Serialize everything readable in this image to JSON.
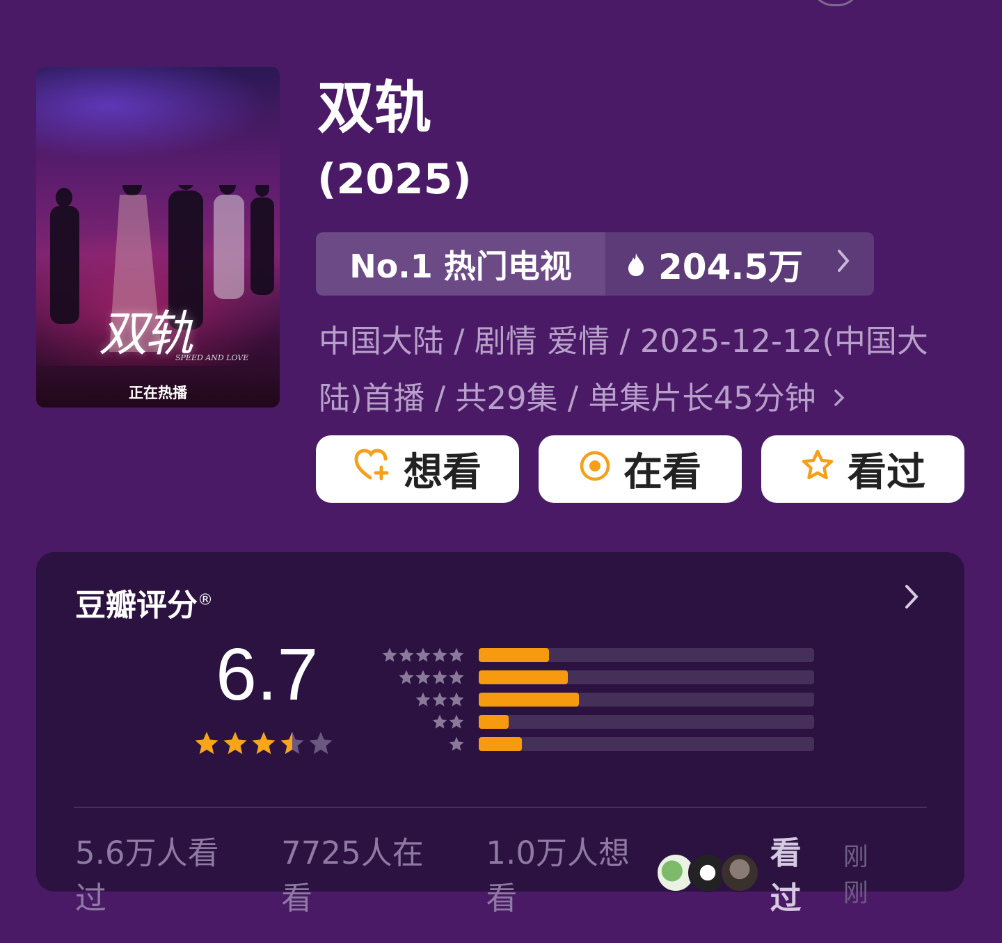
{
  "poster": {
    "art_title": "双轨",
    "art_subtitle": "SPEED AND LOVE",
    "tag": "正在热播"
  },
  "show": {
    "title": "双轨",
    "year": "(2025)"
  },
  "rank": {
    "label": "No.1 热门电视",
    "heat": "204.5万",
    "icon": "flame-icon"
  },
  "meta": {
    "text": "中国大陆 / 剧情 爱情 / 2025-12-12(中国大陆)首播 / 共29集 / 单集片长45分钟"
  },
  "actions": {
    "want": "想看",
    "doing": "在看",
    "done": "看过"
  },
  "rating": {
    "title": "豆瓣评分",
    "reg_mark": "®",
    "score": "6.7",
    "stars": 3.5,
    "distribution": [
      {
        "stars": 5,
        "fraction": 0.21
      },
      {
        "stars": 4,
        "fraction": 0.265
      },
      {
        "stars": 3,
        "fraction": 0.3
      },
      {
        "stars": 2,
        "fraction": 0.09
      },
      {
        "stars": 1,
        "fraction": 0.13
      }
    ]
  },
  "stats": {
    "watched": "5.6万人看过",
    "watching": "7725人在看",
    "wanting": "1.0万人想看",
    "friends_action": "看过",
    "friends_time": "刚刚"
  },
  "colors": {
    "background": "#4a1a66",
    "card": "#2b1240",
    "accent": "#f89a10",
    "star": "#f8a51a"
  }
}
